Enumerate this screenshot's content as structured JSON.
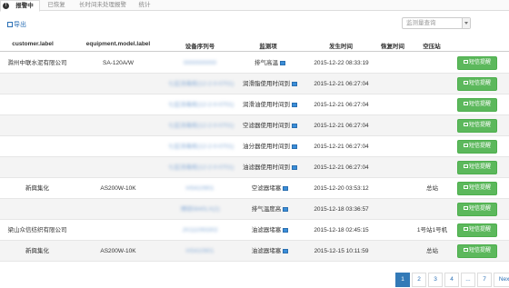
{
  "tabs": [
    {
      "label": "报警中",
      "active": true
    },
    {
      "label": "已恢复"
    },
    {
      "label": "长时间未处理报警"
    },
    {
      "label": "统计"
    }
  ],
  "toolbar": {
    "export_label": "导出",
    "filter_placeholder": "监测量查询"
  },
  "table": {
    "headers": [
      "customer.label",
      "equipment.model.label",
      "设备序列号",
      "监测项",
      "发生时间",
      "恢复时间",
      "空压站",
      ""
    ],
    "action_label": "短信提醒",
    "rows": [
      {
        "customer": "滁州中联水泥有限公司",
        "model": "SA-120A/W",
        "serial": "0000000000",
        "item": "排气高温",
        "time": "2015-12-22 08:33:19",
        "recover": "",
        "station": ""
      },
      {
        "customer": "",
        "model": "",
        "serial": "七层消毒柜(12-2-0-0701)",
        "item": "润滑脂使用时间到",
        "time": "2015-12-21 06:27:04",
        "recover": "",
        "station": ""
      },
      {
        "customer": "",
        "model": "",
        "serial": "七层消毒柜(12-2-0-0701)",
        "item": "润滑油使用时间到",
        "time": "2015-12-21 06:27:04",
        "recover": "",
        "station": ""
      },
      {
        "customer": "",
        "model": "",
        "serial": "七层消毒柜(12-2-0-0701)",
        "item": "空滤器使用时间到",
        "time": "2015-12-21 06:27:04",
        "recover": "",
        "station": ""
      },
      {
        "customer": "",
        "model": "",
        "serial": "七层消毒柜(12-2-0-0701)",
        "item": "油分器使用时间到",
        "time": "2015-12-21 06:27:04",
        "recover": "",
        "station": ""
      },
      {
        "customer": "",
        "model": "",
        "serial": "七层消毒柜(12-2-0-0701)",
        "item": "油滤器使用时间到",
        "time": "2015-12-21 06:27:04",
        "recover": "",
        "station": ""
      },
      {
        "customer": "新興集化",
        "model": "AS200W-10K",
        "serial": "HS410901",
        "item": "空滤器堵塞",
        "time": "2015-12-20 03:53:12",
        "recover": "",
        "station": "总站"
      },
      {
        "customer": "",
        "model": "",
        "serial": "博硕5840LX(2)",
        "item": "排气温度高",
        "time": "2015-12-18 03:36:57",
        "recover": "",
        "station": ""
      },
      {
        "customer": "梁山众信纺织有限公司",
        "model": "",
        "serial": "JX111093302",
        "item": "油滤器堵塞",
        "time": "2015-12-18 02:45:15",
        "recover": "",
        "station": "1号站1号机"
      },
      {
        "customer": "新興集化",
        "model": "AS200W-10K",
        "serial": "HS410901",
        "item": "油滤器堵塞",
        "time": "2015-12-15 10:11:59",
        "recover": "",
        "station": "总站"
      }
    ]
  },
  "pagination": {
    "pages": [
      "1",
      "2",
      "3",
      "4",
      "...",
      "7",
      "Next"
    ],
    "current": "1"
  },
  "colors": {
    "primary": "#337ab7",
    "success": "#5cb85c",
    "link": "#2a6fb5"
  }
}
